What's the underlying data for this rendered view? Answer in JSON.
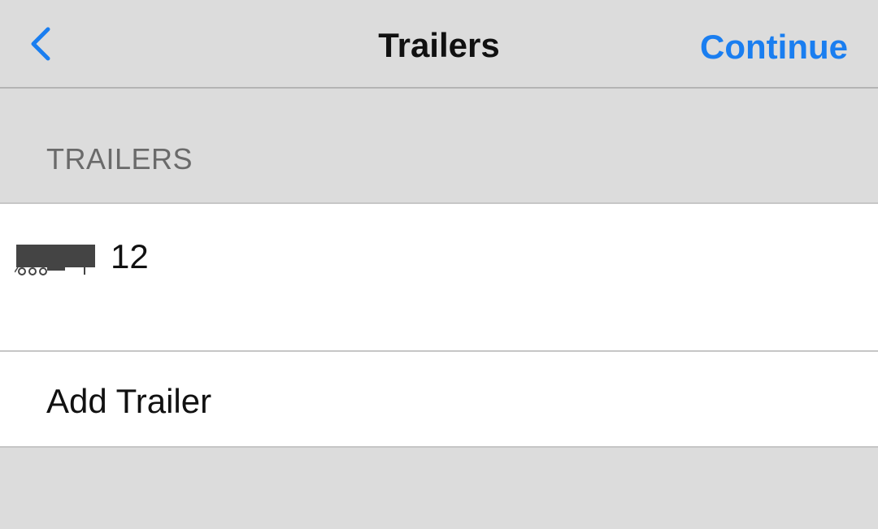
{
  "navbar": {
    "back_icon": "chevron-left-icon",
    "title": "Trailers",
    "continue_label": "Continue"
  },
  "section": {
    "header": "TRAILERS"
  },
  "trailers": [
    {
      "icon": "trailer-icon",
      "number": "12"
    }
  ],
  "add_trailer_label": "Add Trailer",
  "colors": {
    "accent": "#1a7ef0",
    "background": "#dcdcdc",
    "row_background": "#ffffff",
    "section_text": "#6a6a6a"
  }
}
